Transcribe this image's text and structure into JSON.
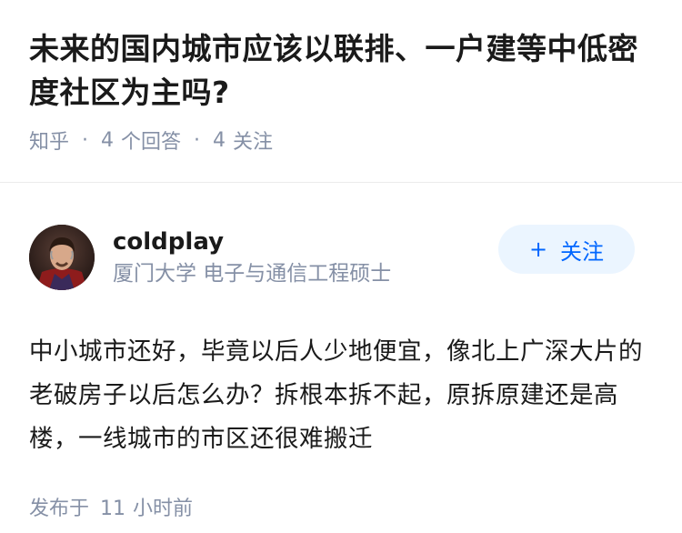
{
  "question": {
    "title": "未来的国内城市应该以联排、一户建等中低密度社区为主吗?",
    "source": "知乎",
    "separator": "·",
    "answer_count": "4",
    "answer_label": "个回答",
    "follow_count": "4",
    "follow_label": "关注"
  },
  "answer": {
    "author": {
      "name": "coldplay",
      "description": "厦门大学 电子与通信工程硕士",
      "avatar_icon": "user-avatar"
    },
    "follow_button": {
      "plus": "+",
      "label": "关注"
    },
    "content": "中小城市还好，毕竟以后人少地便宜，像北上广深大片的老破房子以后怎么办？拆根本拆不起，原拆原建还是高楼，一线城市的市区还很难搬迁",
    "time_prefix": "发布于",
    "time_value": "11",
    "time_suffix": "小时前"
  },
  "colors": {
    "accent": "#0066ff",
    "accent_bg": "#ebf5ff",
    "meta_text": "#8590a6"
  }
}
